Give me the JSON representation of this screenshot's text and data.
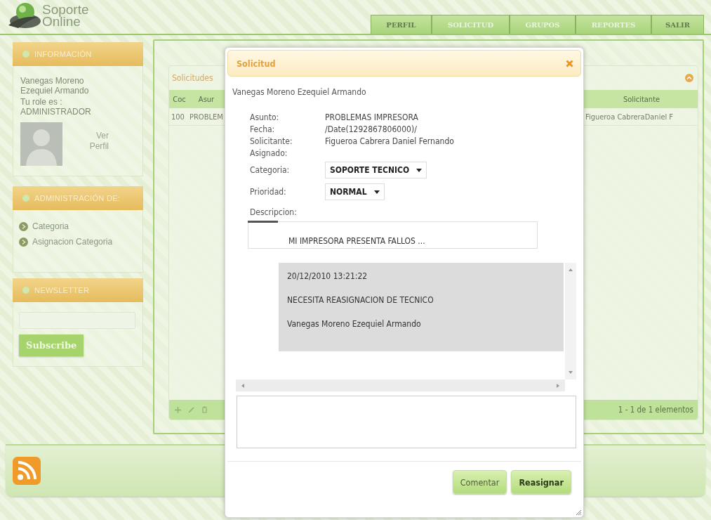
{
  "header": {
    "logo_line_1": "Soporte",
    "logo_line_2": "Online"
  },
  "nav": {
    "tabs": [
      {
        "label": "PERFIL",
        "disabled": false
      },
      {
        "label": "SOLICITUD",
        "disabled": true
      },
      {
        "label": "GRUPOS",
        "disabled": true
      },
      {
        "label": "REPORTES",
        "disabled": true
      },
      {
        "label": "SALIR",
        "disabled": false
      }
    ]
  },
  "sidebar": {
    "panels": [
      {
        "kind": "info",
        "title": "INFORMACIÓN",
        "user_name": "Vanegas Moreno Ezequiel Armando",
        "role_label": "Tu role es :",
        "role": "ADMINISTRADOR",
        "profile_link": "Ver Perfil"
      },
      {
        "kind": "links",
        "title": "ADMINISTRACIÓN DE:",
        "items": [
          "Categoria",
          "Asignacion Categoria"
        ]
      },
      {
        "kind": "newsletter",
        "title": "NEWSLETTER",
        "button": "Subscribe"
      }
    ]
  },
  "grid": {
    "title": "Solicitudes",
    "columns": [
      "Coc",
      "Asur",
      "Solicitante"
    ],
    "rows": [
      {
        "cells": [
          "100",
          "PROBLEM",
          "Figueroa CabreraDaniel F"
        ]
      }
    ],
    "pager": "1 - 1 de 1 elementos"
  },
  "dialog": {
    "title": "Solicitud",
    "user": "Vanegas Moreno Ezequiel Armando",
    "fields": [
      {
        "kind": "text",
        "label": "Asunto:",
        "value": "PROBLEMAS IMPRESORA"
      },
      {
        "kind": "text",
        "label": "Fecha:",
        "value": "/Date(1292867806000)/"
      },
      {
        "kind": "text",
        "label": "Solicitante:",
        "value": "Figueroa Cabrera Daniel Fernando"
      },
      {
        "kind": "text",
        "label": "Asignado:"
      },
      {
        "kind": "select",
        "label": "Categoria:",
        "value": "SOPORTE TECNICO"
      },
      {
        "kind": "select",
        "label": "Prioridad:",
        "value": "NORMAL"
      }
    ],
    "description": {
      "label": "Descripcion:",
      "text": "MI IMPRESORA PRESENTA FALLOS ..."
    },
    "comments": [
      {
        "date": "20/12/2010 13:21:22",
        "text": "NECESITA REASIGNACION DE TECNICO",
        "author": "Vanegas Moreno Ezequiel Armando"
      }
    ],
    "buttons": [
      {
        "label": "Comentar",
        "primary": false
      },
      {
        "label": "Reasignar",
        "primary": true
      }
    ]
  }
}
